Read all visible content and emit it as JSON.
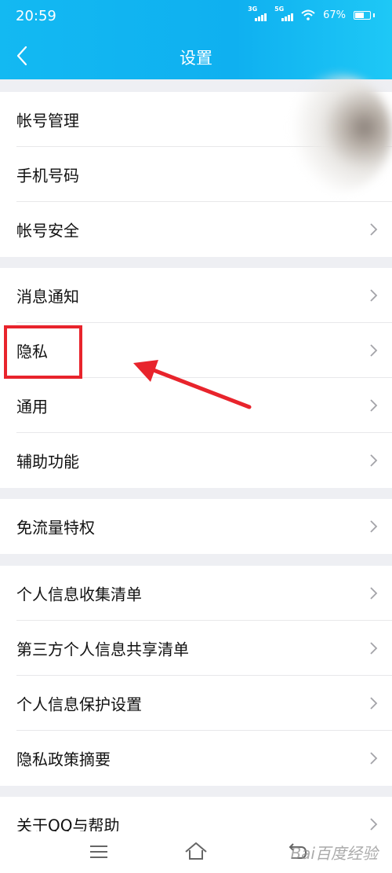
{
  "status_bar": {
    "time": "20:59",
    "network_1": "3G",
    "network_2": "5G",
    "battery": "67%",
    "battery_level": 0.67
  },
  "header": {
    "title": "设置",
    "color": "#12b7f1"
  },
  "groups": [
    {
      "items": [
        {
          "label": "帐号管理",
          "chevron": false
        },
        {
          "label": "手机号码",
          "chevron": false
        },
        {
          "label": "帐号安全",
          "chevron": true
        }
      ]
    },
    {
      "items": [
        {
          "label": "消息通知",
          "chevron": true
        },
        {
          "label": "隐私",
          "chevron": true,
          "highlighted": true
        },
        {
          "label": "通用",
          "chevron": true
        },
        {
          "label": "辅助功能",
          "chevron": true
        }
      ]
    },
    {
      "items": [
        {
          "label": "免流量特权",
          "chevron": true
        }
      ]
    },
    {
      "items": [
        {
          "label": "个人信息收集清单",
          "chevron": true
        },
        {
          "label": "第三方个人信息共享清单",
          "chevron": true
        },
        {
          "label": "个人信息保护设置",
          "chevron": true
        },
        {
          "label": "隐私政策摘要",
          "chevron": true
        }
      ]
    },
    {
      "items": [
        {
          "label": "关于QQ与帮助",
          "chevron": true
        }
      ]
    }
  ],
  "annotation": {
    "color": "#e8242c"
  },
  "watermark": "Bai百度经验",
  "icons": [
    "back-icon",
    "chevron-right-icon",
    "menu-icon",
    "home-icon",
    "return-icon",
    "wifi-icon",
    "battery-icon",
    "signal-icon"
  ]
}
